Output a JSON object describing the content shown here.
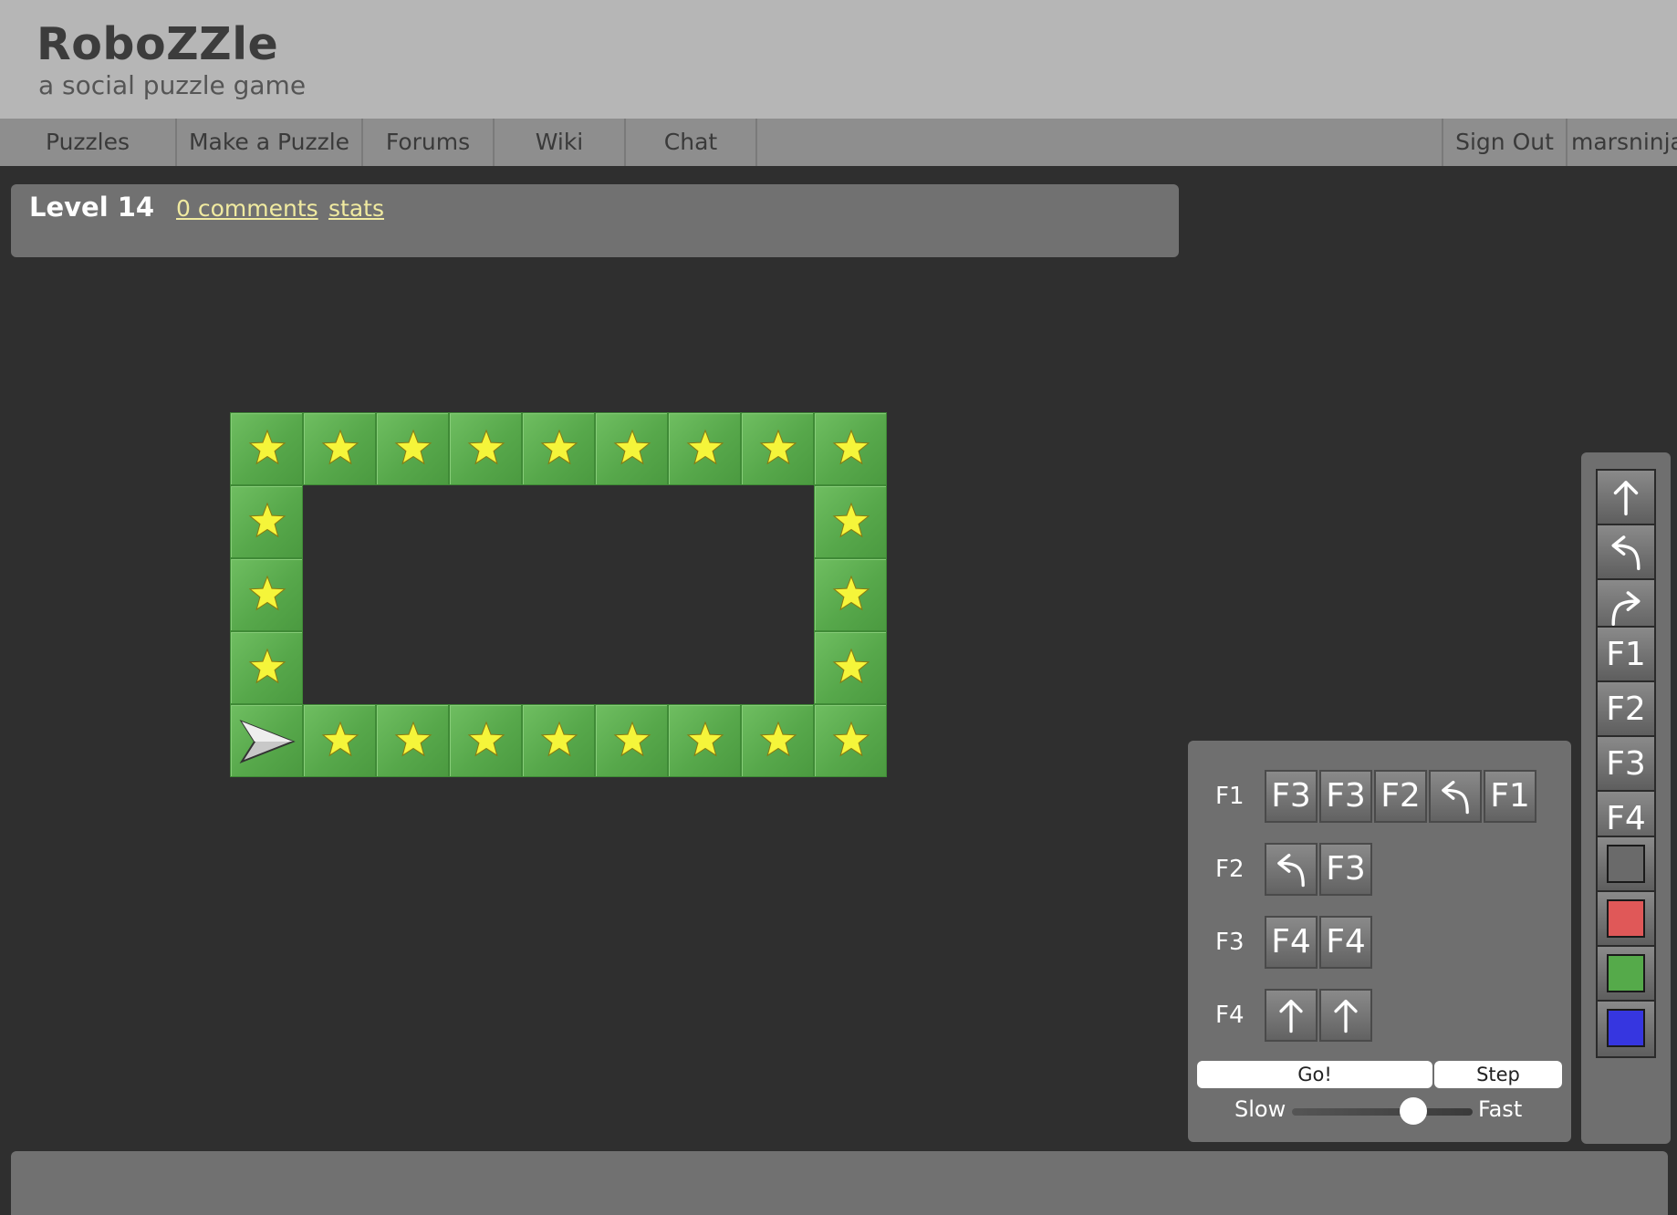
{
  "header": {
    "logo": "RoboZZle",
    "tagline": "a social puzzle game"
  },
  "nav": {
    "items": [
      "Puzzles",
      "Make a Puzzle",
      "Forums",
      "Wiki",
      "Chat"
    ],
    "sign_out": "Sign Out",
    "username": "marsninja"
  },
  "level": {
    "title": "Level 14",
    "comments_link": "0 comments",
    "stats_link": "stats"
  },
  "board": {
    "cols": 9,
    "rows": 5,
    "tile_color": "#5aab4e",
    "star_color": "#f5f53a",
    "robot": {
      "row": 4,
      "col": 0,
      "facing": "right"
    },
    "tiles": [
      {
        "row": 0,
        "col": 0,
        "star": true
      },
      {
        "row": 0,
        "col": 1,
        "star": true
      },
      {
        "row": 0,
        "col": 2,
        "star": true
      },
      {
        "row": 0,
        "col": 3,
        "star": true
      },
      {
        "row": 0,
        "col": 4,
        "star": true
      },
      {
        "row": 0,
        "col": 5,
        "star": true
      },
      {
        "row": 0,
        "col": 6,
        "star": true
      },
      {
        "row": 0,
        "col": 7,
        "star": true
      },
      {
        "row": 0,
        "col": 8,
        "star": true
      },
      {
        "row": 1,
        "col": 0,
        "star": true
      },
      {
        "row": 1,
        "col": 8,
        "star": true
      },
      {
        "row": 2,
        "col": 0,
        "star": true
      },
      {
        "row": 2,
        "col": 8,
        "star": true
      },
      {
        "row": 3,
        "col": 0,
        "star": true
      },
      {
        "row": 3,
        "col": 8,
        "star": true
      },
      {
        "row": 4,
        "col": 0,
        "star": false
      },
      {
        "row": 4,
        "col": 1,
        "star": true
      },
      {
        "row": 4,
        "col": 2,
        "star": true
      },
      {
        "row": 4,
        "col": 3,
        "star": true
      },
      {
        "row": 4,
        "col": 4,
        "star": true
      },
      {
        "row": 4,
        "col": 5,
        "star": true
      },
      {
        "row": 4,
        "col": 6,
        "star": true
      },
      {
        "row": 4,
        "col": 7,
        "star": true
      },
      {
        "row": 4,
        "col": 8,
        "star": true
      }
    ]
  },
  "program": {
    "functions": [
      {
        "label": "F1",
        "slots": [
          "F3",
          "F3",
          "F2",
          "turn-left",
          "F1"
        ]
      },
      {
        "label": "F2",
        "slots": [
          "turn-left",
          "F3"
        ]
      },
      {
        "label": "F3",
        "slots": [
          "F4",
          "F4"
        ]
      },
      {
        "label": "F4",
        "slots": [
          "forward",
          "forward"
        ]
      }
    ],
    "go_label": "Go!",
    "step_label": "Step",
    "speed": {
      "slow_label": "Slow",
      "fast_label": "Fast",
      "value": 0.67
    }
  },
  "toolbox": {
    "moves": [
      "forward-icon",
      "turn-left-icon",
      "turn-right-icon"
    ],
    "functions": [
      "F1",
      "F2",
      "F3",
      "F4"
    ],
    "colors": [
      {
        "name": "gray",
        "hex": "#6a6a6a"
      },
      {
        "name": "red",
        "hex": "#e05858"
      },
      {
        "name": "green",
        "hex": "#55aa4a"
      },
      {
        "name": "blue",
        "hex": "#3636e0"
      }
    ]
  }
}
